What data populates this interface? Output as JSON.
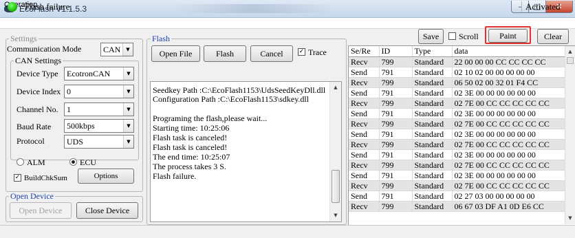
{
  "window": {
    "title": "EcoFlash V1.1.5.3"
  },
  "menu": {
    "operation": "Operation"
  },
  "settings": {
    "group_label": "Settings",
    "comm_mode_label": "Communication Mode",
    "comm_mode_value": "CAN",
    "can_settings_label": "CAN Settings",
    "device_type_label": "Device Type",
    "device_type_value": "EcotronCAN",
    "device_index_label": "Device Index",
    "device_index_value": "0",
    "channel_no_label": "Channel No.",
    "channel_no_value": "1",
    "baud_rate_label": "Baud Rate",
    "baud_rate_value": "500kbps",
    "protocol_label": "Protocol",
    "protocol_value": "UDS",
    "alm_label": "ALM",
    "ecu_label": "ECU",
    "selected_mode": "ECU",
    "build_checksum_label": "BuildChkSum",
    "build_checksum_checked": true,
    "options_button": "Options"
  },
  "open_device": {
    "group_label": "Open Device",
    "open_button": "Open Device",
    "close_button": "Close Device"
  },
  "flash": {
    "group_label": "Flash",
    "open_file_button": "Open File",
    "flash_button": "Flash",
    "cancel_button": "Cancel",
    "trace_label": "Trace",
    "trace_checked": true,
    "log_lines": [
      "Seedkey Path :C:\\EcoFlash1153\\UdsSeedKeyDll.dll",
      "Configuration Path :C:\\EcoFlash1153\\sdkey.dll",
      "",
      "Programing the flash,please wait...",
      "Starting time: 10:25:06",
      "Flash task is canceled!",
      "Flash task is canceled!",
      "The end time: 10:25:07",
      "The process takes 3 S.",
      "Flash failure."
    ]
  },
  "toolbar": {
    "save_button": "Save",
    "scroll_label": "Scroll",
    "scroll_checked": false,
    "paint_button": "Paint",
    "clear_button": "Clear",
    "highlight_color": "#e03030"
  },
  "table": {
    "columns": [
      "Se/Re",
      "ID",
      "Type",
      "data"
    ],
    "rows": [
      [
        "Recv",
        "799",
        "Standard",
        "22  00  00  00  CC  CC  CC  CC"
      ],
      [
        "Send",
        "791",
        "Standard",
        "02  10  02  00  00  00  00  00"
      ],
      [
        "Recv",
        "799",
        "Standard",
        "06  50  02  00  32  01  F4  CC"
      ],
      [
        "Send",
        "791",
        "Standard",
        "02  3E  00  00  00  00  00  00"
      ],
      [
        "Recv",
        "799",
        "Standard",
        "02  7E  00  CC  CC  CC  CC  CC"
      ],
      [
        "Send",
        "791",
        "Standard",
        "02  3E  00  00  00  00  00  00"
      ],
      [
        "Recv",
        "799",
        "Standard",
        "02  7E  00  CC  CC  CC  CC  CC"
      ],
      [
        "Send",
        "791",
        "Standard",
        "02  3E  00  00  00  00  00  00"
      ],
      [
        "Recv",
        "799",
        "Standard",
        "02  7E  00  CC  CC  CC  CC  CC"
      ],
      [
        "Send",
        "791",
        "Standard",
        "02  3E  00  00  00  00  00  00"
      ],
      [
        "Recv",
        "799",
        "Standard",
        "02  7E  00  CC  CC  CC  CC  CC"
      ],
      [
        "Send",
        "791",
        "Standard",
        "02  3E  00  00  00  00  00  00"
      ],
      [
        "Recv",
        "799",
        "Standard",
        "02  7E  00  CC  CC  CC  CC  CC"
      ],
      [
        "Send",
        "791",
        "Standard",
        "02  27  03  00  00  00  00  00"
      ],
      [
        "Recv",
        "799",
        "Standard",
        "06  67  03  DF  A1  0D  E6  CC"
      ]
    ]
  },
  "status": {
    "message": "Flash failure.",
    "state": "Activated",
    "indicator_color": "#22c810"
  }
}
